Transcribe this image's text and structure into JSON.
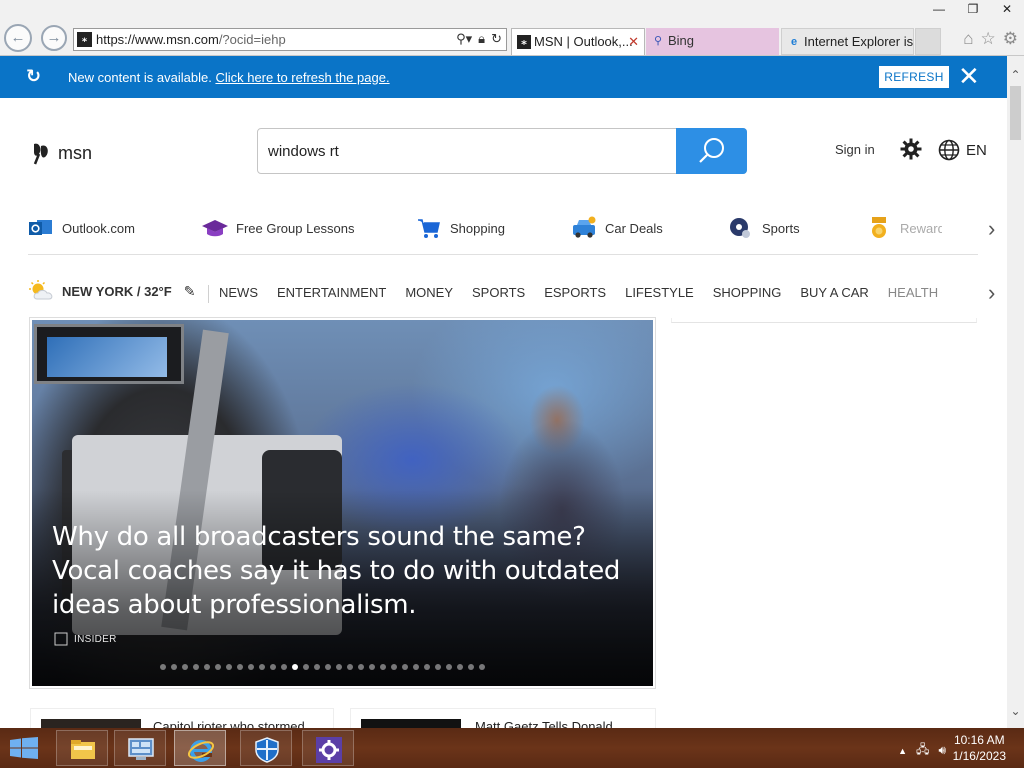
{
  "window": {
    "minimize": "—",
    "restore": "❐",
    "close": "✕"
  },
  "browser": {
    "url_main": "https://www.msn.com",
    "url_rest": "/?ocid=iehp",
    "tabs": [
      {
        "label": "MSN | Outlook,...",
        "icon": "msn-icon",
        "active": true
      },
      {
        "label": "Bing",
        "icon": "search-icon"
      },
      {
        "label": "Internet Explorer is...",
        "icon": "ie-icon"
      }
    ],
    "tools": [
      "home-icon",
      "star-icon",
      "gear-icon"
    ]
  },
  "notification": {
    "message": "New content is available.",
    "link": "Click here to refresh the page.",
    "button": "REFRESH",
    "close": "✕"
  },
  "header": {
    "logo": "msn",
    "search_value": "windows rt",
    "sign_in": "Sign in",
    "lang": "EN"
  },
  "quick_links": [
    {
      "label": "Outlook.com",
      "icon": "outlook-icon"
    },
    {
      "label": "Free Group Lessons",
      "icon": "graduation-cap-icon"
    },
    {
      "label": "Shopping",
      "icon": "shopping-cart-icon"
    },
    {
      "label": "Car Deals",
      "icon": "car-icon"
    },
    {
      "label": "Sports",
      "icon": "ball-icon"
    },
    {
      "label": "Rewards",
      "icon": "medal-icon"
    }
  ],
  "weather": {
    "label": "NEW YORK / 32°F",
    "icon": "partly-sunny-icon"
  },
  "nav": [
    "NEWS",
    "ENTERTAINMENT",
    "MONEY",
    "SPORTS",
    "ESPORTS",
    "LIFESTYLE",
    "SHOPPING",
    "BUY A CAR",
    "HEALTH"
  ],
  "hero": {
    "headline": "Why do all broadcasters sound the same? Vocal coaches say it has to do with outdated ideas about professionalism.",
    "source": "INSIDER",
    "slide_count": 30,
    "active_slide": 12
  },
  "cards": [
    {
      "title": "Capitol rioter who stormed"
    },
    {
      "title": "Matt Gaetz Tells Donald"
    }
  ],
  "taskbar": {
    "apps": [
      "file-explorer-icon",
      "control-panel-icon",
      "internet-explorer-icon",
      "shield-icon",
      "settings-icon"
    ],
    "time": "10:16 AM",
    "date": "1/16/2023"
  },
  "colors": {
    "accent": "#2d8fe5",
    "notify_bar": "#0a74c7",
    "taskbar": "#5a2a14"
  }
}
